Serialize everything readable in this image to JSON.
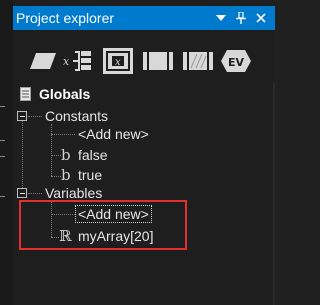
{
  "window": {
    "title": "Project explorer",
    "buttons": {
      "menu": "dropdown-menu",
      "pin": "pin",
      "close": "close"
    }
  },
  "toolbar": {
    "tools": [
      {
        "name": "parallelogram-tool",
        "icon": "parallelogram-icon"
      },
      {
        "name": "assignment-tool",
        "icon": "assignment-icon",
        "text": "x"
      },
      {
        "name": "call-tool",
        "icon": "call-icon",
        "text": "x"
      },
      {
        "name": "block-tool",
        "icon": "block-icon"
      },
      {
        "name": "hatched-block-tool",
        "icon": "hatched-block-icon"
      },
      {
        "name": "ev-tool",
        "icon": "ev-tool-icon",
        "text": "EV"
      }
    ]
  },
  "tree": {
    "root": {
      "label": "Globals",
      "icon": "document-icon"
    },
    "constants": {
      "label": "Constants",
      "items": [
        {
          "label": "<Add new>"
        },
        {
          "label": "false",
          "type_glyph": "b"
        },
        {
          "label": "true",
          "type_glyph": "b"
        }
      ]
    },
    "variables": {
      "label": "Variables",
      "items": [
        {
          "label": "<Add new>",
          "selected": true
        },
        {
          "label": "myArray[20]",
          "type_glyph": "ℝ"
        }
      ]
    }
  },
  "colors": {
    "title_bar": "#007acc",
    "panel_bg": "#1e1e1e",
    "highlight": "#e03030"
  }
}
